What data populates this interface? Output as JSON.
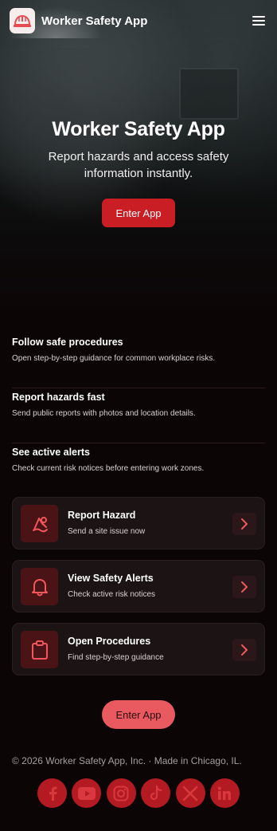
{
  "header": {
    "app_name": "Worker Safety App",
    "logo_icon": "hard-hat-icon",
    "menu_icon": "hamburger-menu-icon"
  },
  "hero": {
    "title": "Worker Safety App",
    "subtitle": "Report hazards and access safety information instantly.",
    "cta_label": "Enter App"
  },
  "features": [
    {
      "title": "Follow safe procedures",
      "description": "Open step-by-step guidance for common workplace risks."
    },
    {
      "title": "Report hazards fast",
      "description": "Send public reports with photos and location details."
    },
    {
      "title": "See active alerts",
      "description": "Check current risk notices before entering work zones."
    }
  ],
  "actions": [
    {
      "title": "Report Hazard",
      "subtitle": "Send a site issue now",
      "icon": "hazard-report-icon"
    },
    {
      "title": "View Safety Alerts",
      "subtitle": "Check active risk notices",
      "icon": "bell-icon"
    },
    {
      "title": "Open Procedures",
      "subtitle": "Find step-by-step guidance",
      "icon": "clipboard-icon"
    }
  ],
  "footer": {
    "cta_label": "Enter App",
    "copyright": "© 2026 Worker Safety App, Inc. · Made in Chicago, IL.",
    "socials": [
      "facebook-icon",
      "youtube-icon",
      "instagram-icon",
      "tiktok-icon",
      "x-icon",
      "linkedin-icon"
    ]
  },
  "colors": {
    "accent": "#c81e24",
    "accent_light": "#e95a60",
    "background": "#0c0506",
    "card": "#1b1314"
  }
}
